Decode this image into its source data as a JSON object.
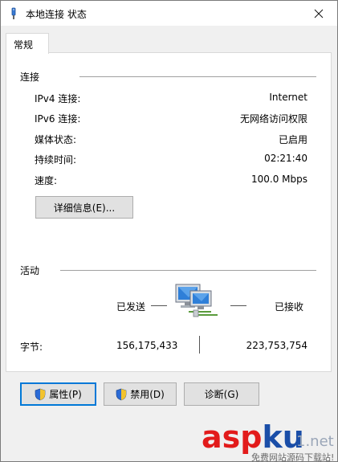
{
  "window": {
    "title": "本地连接 状态"
  },
  "tabs": [
    {
      "label": "常规"
    }
  ],
  "connection": {
    "group_label": "连接",
    "rows": [
      {
        "label": "IPv4 连接:",
        "value": "Internet"
      },
      {
        "label": "IPv6 连接:",
        "value": "无网络访问权限"
      },
      {
        "label": "媒体状态:",
        "value": "已启用"
      },
      {
        "label": "持续时间:",
        "value": "02:21:40"
      },
      {
        "label": "速度:",
        "value": "100.0 Mbps"
      }
    ],
    "details_button": "详细信息(E)..."
  },
  "activity": {
    "group_label": "活动",
    "sent_label": "已发送",
    "received_label": "已接收",
    "bytes_label": "字节:",
    "bytes_sent": "156,175,433",
    "bytes_received": "223,753,754"
  },
  "buttons": {
    "properties": "属性(P)",
    "disable": "禁用(D)",
    "diagnose": "诊断(G)"
  },
  "watermark": {
    "brand": "aspku",
    "suffix": "1.net",
    "tagline": "免费网站源码下载站!"
  },
  "icons": {
    "title": "network-adapter-icon",
    "close": "close-icon",
    "activity": "network-computers-icon",
    "shield": "uac-shield-icon"
  }
}
